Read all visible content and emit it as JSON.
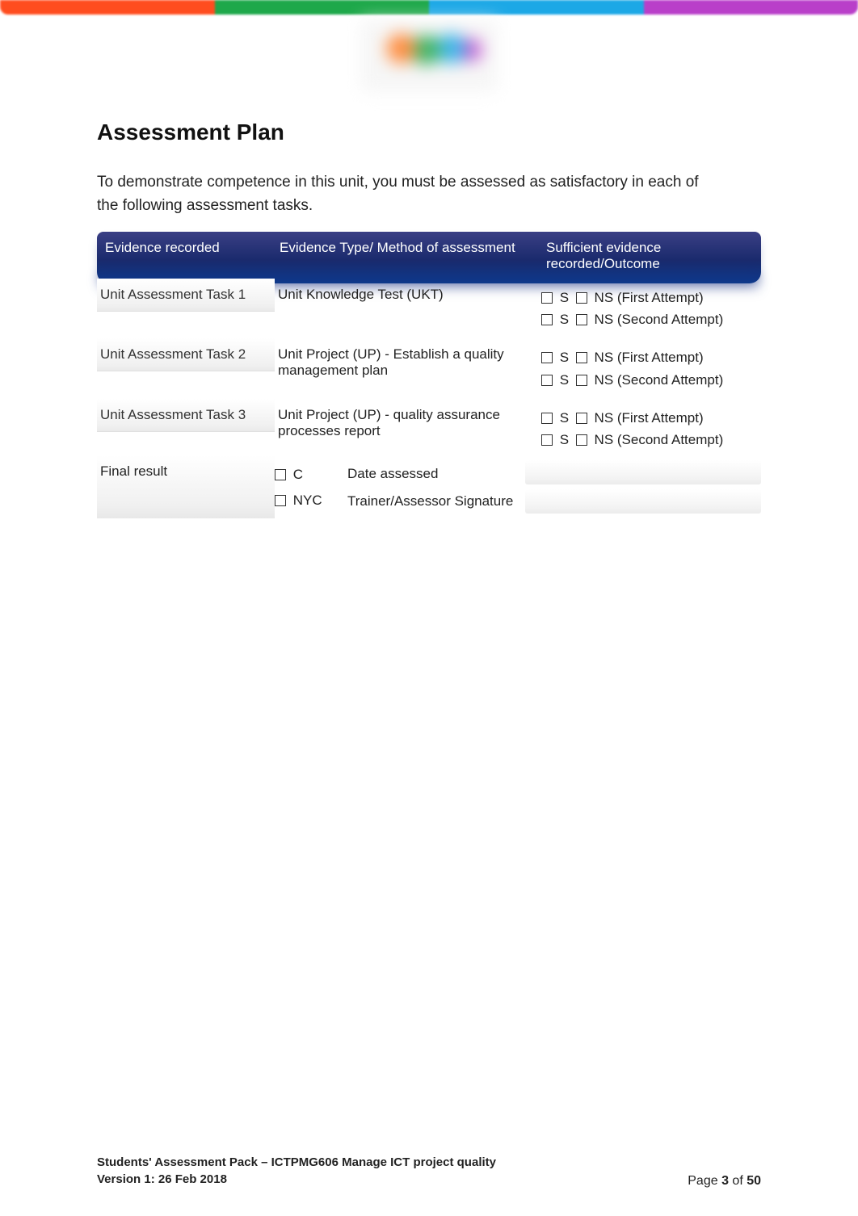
{
  "heading": "Assessment Plan",
  "intro": "To demonstrate competence in this unit, you must be assessed as satisfactory in each of the following assessment tasks.",
  "table": {
    "headers": {
      "col1": "Evidence recorded",
      "col2": "Evidence Type/ Method of assessment",
      "col3_line1": "Sufficient evidence",
      "col3_line2": "recorded/Outcome"
    },
    "rows": [
      {
        "task": "Unit Assessment Task 1",
        "method": "Unit Knowledge Test (UKT)",
        "outcome": {
          "s_label": "S",
          "ns_label": "NS (First Attempt)",
          "s2_label": "S",
          "ns2_label": "NS (Second Attempt)"
        }
      },
      {
        "task": "Unit Assessment Task 2",
        "method": "Unit Project (UP) - Establish a quality management plan",
        "outcome": {
          "s_label": "S",
          "ns_label": "NS (First Attempt)",
          "s2_label": "S",
          "ns2_label": "NS (Second Attempt)"
        }
      },
      {
        "task": "Unit Assessment Task 3",
        "method": "Unit Project (UP) - quality assurance processes report",
        "outcome": {
          "s_label": "S",
          "ns_label": "NS (First Attempt)",
          "s2_label": "S",
          "ns2_label": "NS (Second Attempt)"
        }
      }
    ],
    "final": {
      "label": "Final result",
      "c_label": "C",
      "nyc_label": "NYC",
      "date_label": "Date assessed",
      "sig_label": "Trainer/Assessor Signature"
    }
  },
  "footer": {
    "line1": "Students' Assessment Pack – ICTPMG606 Manage ICT project quality",
    "line2": "Version 1:  26 Feb 2018",
    "page_prefix": "Page ",
    "page_num": "3",
    "page_of": " of ",
    "page_total": "50"
  }
}
